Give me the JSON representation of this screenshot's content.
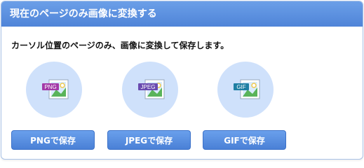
{
  "panel": {
    "title": "現在のページのみ画像に変換する",
    "description": "カーソル位置のページのみ、画像に変換して保存します。"
  },
  "formats": [
    {
      "badge": "PNG",
      "button_label": "PNGで保存",
      "badge_color": "#a33aa8",
      "icon": "png-file-icon"
    },
    {
      "badge": "JPEG",
      "button_label": "JPEGで保存",
      "badge_color": "#6a4bb0",
      "icon": "jpeg-file-icon"
    },
    {
      "badge": "GIF",
      "button_label": "GIFで保存",
      "badge_color": "#1f7fa3",
      "icon": "gif-file-icon"
    }
  ],
  "colors": {
    "header": "#4f84d8",
    "button": "#4a80d6",
    "circle": "#cfe1fb"
  }
}
